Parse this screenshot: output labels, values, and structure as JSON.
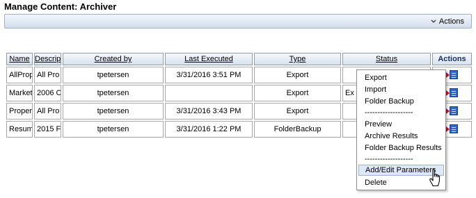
{
  "page": {
    "title": "Manage Content: Archiver"
  },
  "actions_bar": {
    "label": "Actions"
  },
  "table": {
    "columns": [
      "Name",
      "Descrip",
      "Created by",
      "Last Executed",
      "Type",
      "Status",
      "Actions"
    ],
    "rows": [
      {
        "name": "AllProp",
        "description": "All Pro",
        "created_by": "tpetersen",
        "last_executed": "3/31/2016 3:51 PM",
        "type": "Export",
        "status": ""
      },
      {
        "name": "Market",
        "description": "2006 C",
        "created_by": "tpetersen",
        "last_executed": "",
        "type": "Export",
        "status": "Ex"
      },
      {
        "name": "Proper",
        "description": "All Pro",
        "created_by": "tpetersen",
        "last_executed": "3/31/2016 3:43 PM",
        "type": "Export",
        "status": ""
      },
      {
        "name": "Resum",
        "description": "2015 F",
        "created_by": "tpetersen",
        "last_executed": "3/31/2016 1:22 PM",
        "type": "FolderBackup",
        "status": ""
      }
    ]
  },
  "context_menu": {
    "items": [
      "Export",
      "Import",
      "Folder Backup",
      "-------------------",
      "Preview",
      "Archive Results",
      "Folder Backup Results",
      "-------------------",
      "Add/Edit Parameters",
      "Delete"
    ],
    "hovered_item": "Add/Edit Parameters"
  }
}
